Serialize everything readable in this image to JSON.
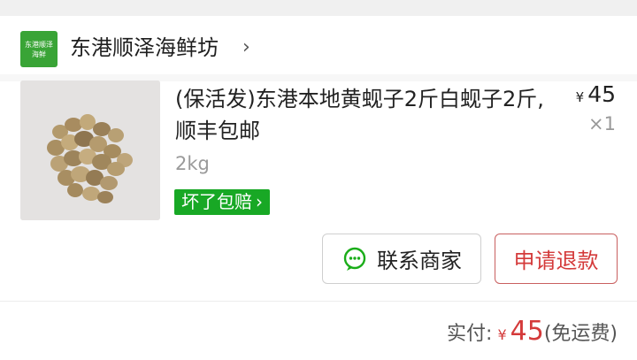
{
  "shop": {
    "logo_text_line1": "东港顺泽",
    "logo_text_line2": "海鲜",
    "name": "东港顺泽海鲜坊",
    "chevron": "›"
  },
  "product": {
    "image_icon": "clam-photo",
    "title": "(保活发)东港本地黄蚬子2斤白蚬子2斤,顺丰包邮",
    "currency": "¥",
    "price": "45",
    "quantity": "×1",
    "spec": "2kg",
    "guarantee_badge": "坏了包赔",
    "guarantee_chevron": "›"
  },
  "actions": {
    "contact_label": "联系商家",
    "contact_icon": "wechat-chat-icon",
    "refund_label": "申请退款"
  },
  "payment": {
    "label": "实付:",
    "currency": "¥",
    "amount": "45",
    "shipping_note": "(免运费)"
  },
  "colors": {
    "brand_green": "#39a436",
    "badge_green": "#18a825",
    "accent_red": "#d43a3a"
  }
}
